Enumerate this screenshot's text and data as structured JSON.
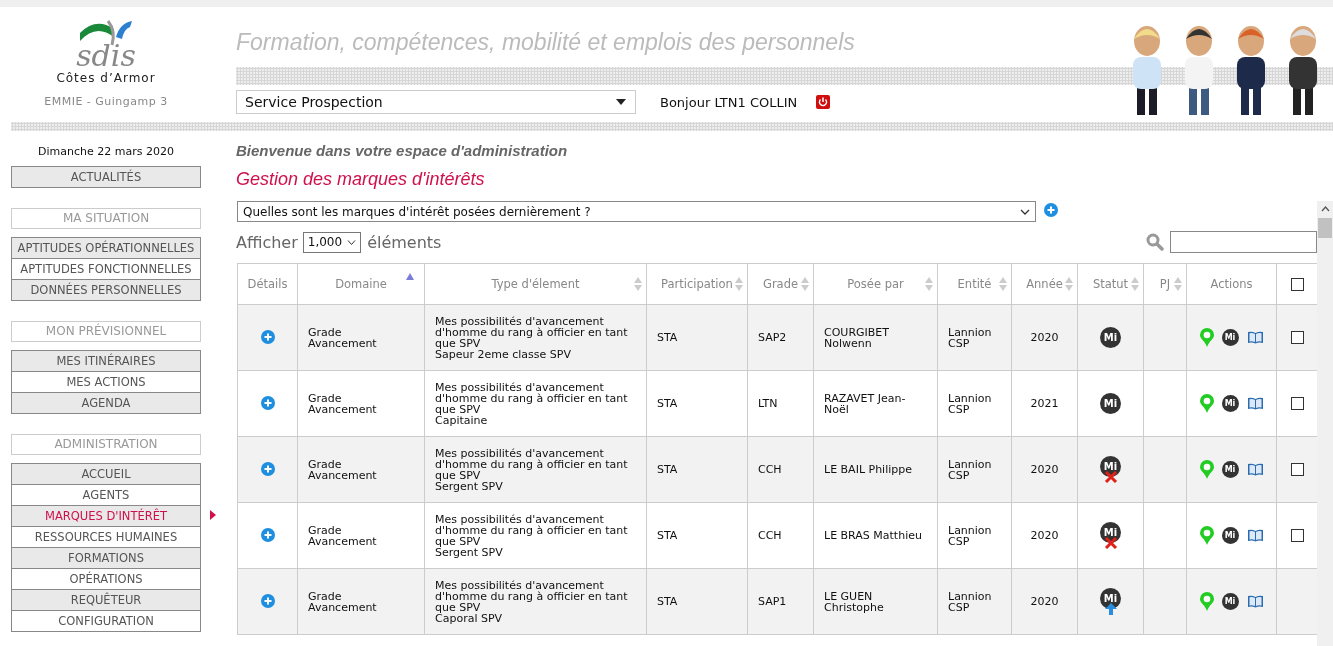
{
  "header": {
    "logo_text": "sdis",
    "logo_subtitle": "Côtes d’Armor",
    "site": "EMMIE - Guingamp 3",
    "title": "Formation, compétences, mobilité et emplois des personnels",
    "service_select": "Service Prospection",
    "greeting": "Bonjour LTN1 COLLIN"
  },
  "date": "Dimanche 22 mars 2020",
  "menu": [
    {
      "items": [
        {
          "label": "ACTUALITÉS",
          "selected": false
        }
      ]
    },
    {
      "heading": "MA SITUATION",
      "items": [
        {
          "label": "APTITUDES OPÉRATIONNELLES",
          "selected": false
        },
        {
          "label": "APTITUDES FONCTIONNELLES",
          "selected": false
        },
        {
          "label": "DONNÉES PERSONNELLES",
          "selected": false
        }
      ]
    },
    {
      "heading": "MON PRÉVISIONNEL",
      "items": [
        {
          "label": "MES ITINÉRAIRES",
          "selected": false
        },
        {
          "label": "MES ACTIONS",
          "selected": false
        },
        {
          "label": "AGENDA",
          "selected": false
        }
      ]
    },
    {
      "heading": "ADMINISTRATION",
      "items": [
        {
          "label": "ACCUEIL",
          "selected": false
        },
        {
          "label": "AGENTS",
          "selected": false
        },
        {
          "label": "MARQUES D'INTÉRÊT",
          "selected": true
        },
        {
          "label": "RESSOURCES HUMAINES",
          "selected": false
        },
        {
          "label": "FORMATIONS",
          "selected": false
        },
        {
          "label": "OPÉRATIONS",
          "selected": false
        },
        {
          "label": "REQUÊTEUR",
          "selected": false
        },
        {
          "label": "CONFIGURATION",
          "selected": false
        }
      ]
    }
  ],
  "welcome": "Bienvenue dans votre espace d'administration",
  "page_title": "Gestion des marques d'intérêts",
  "query_select": "Quelles sont les marques d'intérêt posées dernièrement ?",
  "show_label": "Afficher",
  "page_size": "1,000",
  "show_suffix": "éléments",
  "columns": [
    {
      "label": "Détails"
    },
    {
      "label": "Domaine",
      "sorted": true
    },
    {
      "label": "Type d'élement",
      "sorted": false
    },
    {
      "label": "Participation",
      "sorted": false
    },
    {
      "label": "Grade",
      "sorted": false
    },
    {
      "label": "Posée par",
      "sorted": false
    },
    {
      "label": "Entité",
      "sorted": false
    },
    {
      "label": "Année",
      "sorted": false
    },
    {
      "label": "Statut",
      "sorted": false
    },
    {
      "label": "PJ",
      "sorted": false
    },
    {
      "label": "Actions"
    }
  ],
  "select_all": {
    "checked": false
  },
  "rows": [
    {
      "domain": [
        "Grade",
        "Avancement"
      ],
      "type": [
        "Mes possibilités d'avancement d'homme du rang à officier en tant que SPV",
        "Sapeur 2eme classe SPV"
      ],
      "participation": "STA",
      "grade": "SAP2",
      "posted_by": "COURGIBET Nolwenn",
      "entity": "Lannion CSP",
      "year": "2020",
      "status": {
        "label": "Mi",
        "kind": "plain"
      },
      "action_badge": "Mi",
      "selectable": true,
      "checked": false
    },
    {
      "domain": [
        "Grade",
        "Avancement"
      ],
      "type": [
        "Mes possibilités d'avancement d'homme du rang à officier en tant que SPV",
        "Capitaine"
      ],
      "participation": "STA",
      "grade": "LTN",
      "posted_by": "RAZAVET Jean-Noël",
      "entity": "Lannion CSP",
      "year": "2021",
      "status": {
        "label": "Mi",
        "kind": "plain"
      },
      "action_badge": "Mi",
      "selectable": true,
      "checked": false
    },
    {
      "domain": [
        "Grade",
        "Avancement"
      ],
      "type": [
        "Mes possibilités d'avancement d'homme du rang à officier en tant que SPV",
        "Sergent SPV"
      ],
      "participation": "STA",
      "grade": "CCH",
      "posted_by": "LE BAIL Philippe",
      "entity": "Lannion CSP",
      "year": "2020",
      "status": {
        "label": "Mi",
        "kind": "refused"
      },
      "action_badge": "Mi",
      "selectable": true,
      "checked": false
    },
    {
      "domain": [
        "Grade",
        "Avancement"
      ],
      "type": [
        "Mes possibilités d'avancement d'homme du rang à officier en tant que SPV",
        "Sergent SPV"
      ],
      "participation": "STA",
      "grade": "CCH",
      "posted_by": "LE BRAS Matthieu",
      "entity": "Lannion CSP",
      "year": "2020",
      "status": {
        "label": "Mi",
        "kind": "refused"
      },
      "action_badge": "Mi",
      "selectable": true,
      "checked": false
    },
    {
      "domain": [
        "Grade",
        "Avancement"
      ],
      "type": [
        "Mes possibilités d'avancement d'homme du rang à officier en tant que SPV",
        "Caporal SPV"
      ],
      "participation": "STA",
      "grade": "SAP1",
      "posted_by": "LE GUEN Christophe",
      "entity": "Lannion CSP",
      "year": "2020",
      "status": {
        "label": "Mi",
        "kind": "raised"
      },
      "action_badge": "Mi",
      "selectable": false
    }
  ]
}
